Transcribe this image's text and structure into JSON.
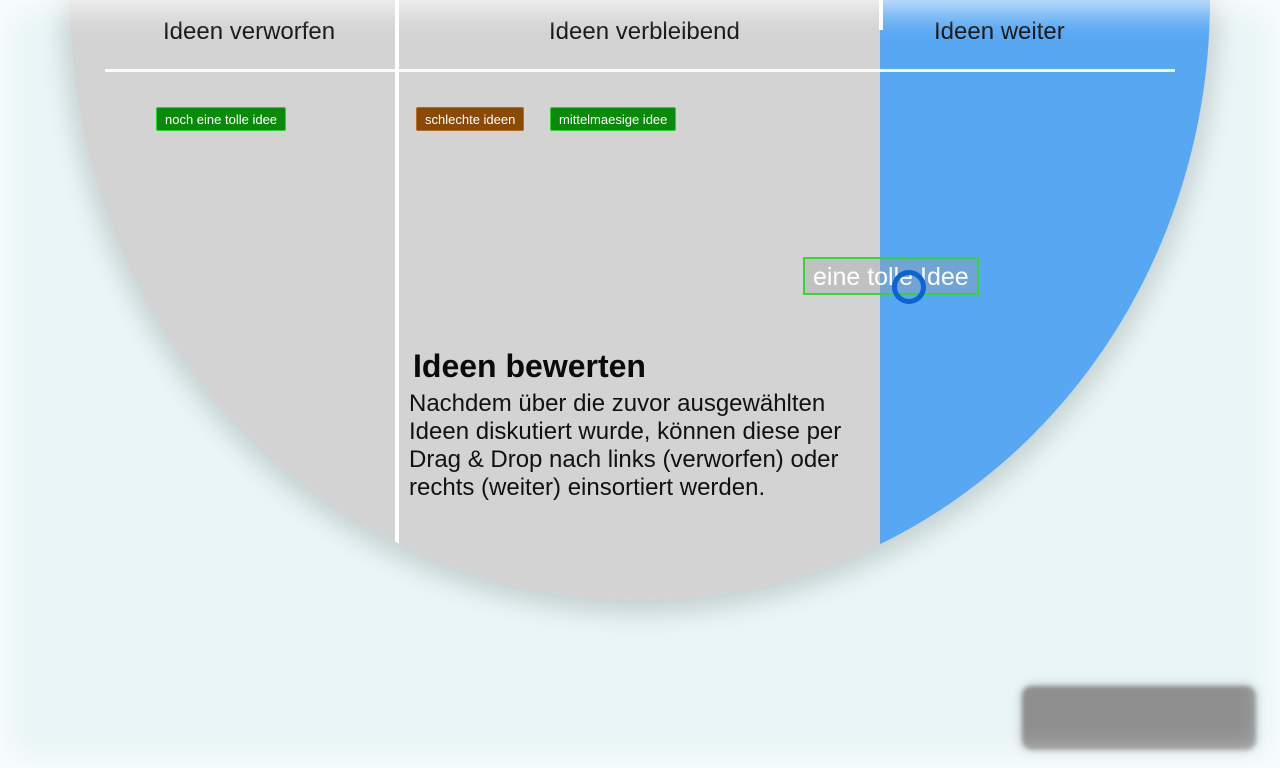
{
  "columns": {
    "rejected_title": "Ideen verworfen",
    "remaining_title": "Ideen verbleibend",
    "accepted_title": "Ideen weiter"
  },
  "ideas": {
    "rejected": [
      "noch eine tolle idee"
    ],
    "remaining": [
      "schlechte ideen",
      "mittelmaesige idee"
    ],
    "dragging": "eine tolle Idee"
  },
  "colors": {
    "accept_column": "#57a7f3",
    "chip_green": "#0a8a0a",
    "chip_brown": "#8a4a06",
    "cursor": "#0b63d6"
  },
  "tooltip": {
    "title": "Ideen bewerten",
    "body": "Nachdem über die zuvor ausgewählten Ideen diskutiert wurde, können diese per Drag & Drop nach links (verworfen) oder rechts (weiter) einsortiert werden."
  },
  "bottom_button": {
    "label": "",
    "icon": "blurred-action-button"
  }
}
